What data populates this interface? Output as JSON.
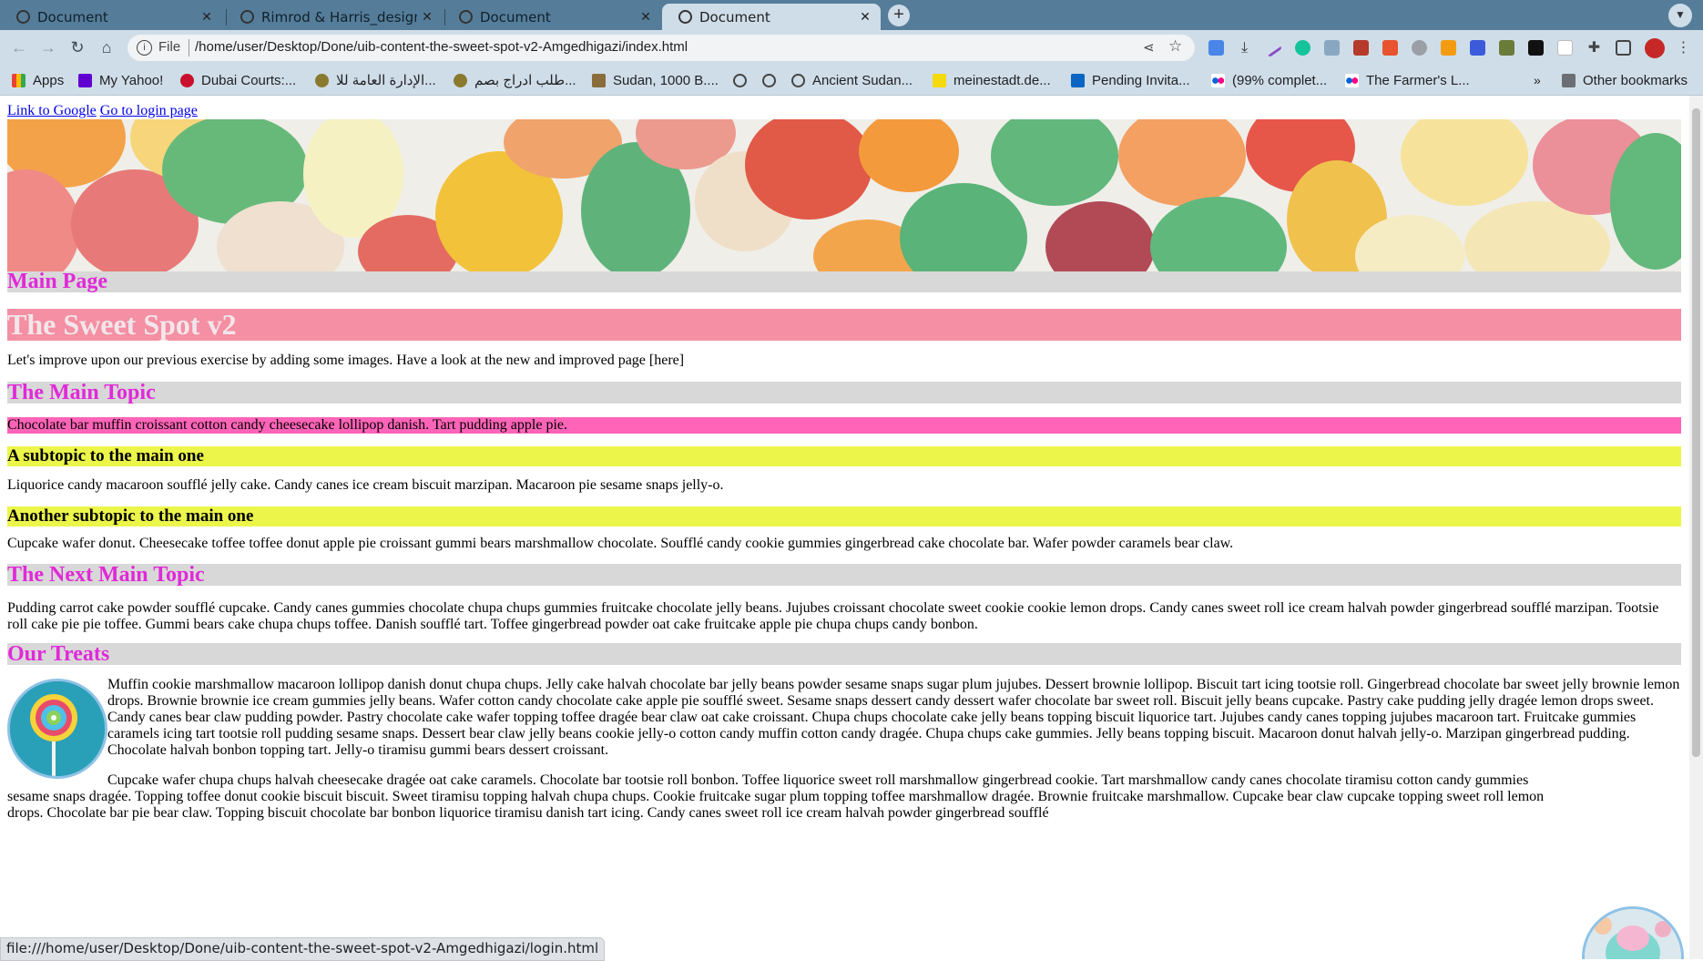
{
  "browser": {
    "tabs": [
      {
        "label": "Document",
        "active": false
      },
      {
        "label": "Rimrod & Harris_design s",
        "active": false
      },
      {
        "label": "Document",
        "active": false
      },
      {
        "label": "Document",
        "active": true
      }
    ],
    "new_tab_symbol": "+",
    "address": {
      "scheme_label": "File",
      "url": "/home/user/Desktop/Done/uib-content-the-sweet-spot-v2-Amgedhigazi/index.html"
    },
    "bookmarks": [
      {
        "label": "Apps",
        "icon": "apps-grid-icon"
      },
      {
        "label": "My Yahoo!",
        "icon": "yahoo-icon"
      },
      {
        "label": "Dubai Courts:...",
        "icon": "dubai-courts-icon"
      },
      {
        "label": "الإدارة العامة للا...",
        "icon": "emblem-icon"
      },
      {
        "label": "طلب ادراج بصم...",
        "icon": "emblem-icon"
      },
      {
        "label": "Sudan, 1000 B....",
        "icon": "folder-image-icon"
      },
      {
        "label": "",
        "icon": "globe-icon"
      },
      {
        "label": "",
        "icon": "globe-icon"
      },
      {
        "label": "Ancient Sudan...",
        "icon": "globe-icon"
      },
      {
        "label": "meinestadt.de...",
        "icon": "meinestadt-icon"
      },
      {
        "label": "Pending Invita...",
        "icon": "linkedin-icon"
      },
      {
        "label": "(99% complet...",
        "icon": "flickr-icon"
      },
      {
        "label": "The Farmer's L...",
        "icon": "flickr-icon"
      }
    ],
    "bookmarks_overflow": "»",
    "other_bookmarks": "Other bookmarks",
    "status_url": "file:///home/user/Desktop/Done/uib-content-the-sweet-spot-v2-Amgedhigazi/login.html"
  },
  "page": {
    "links": {
      "google": "Link to Google",
      "login": "Go to login page"
    },
    "main_page_heading": "Main Page",
    "title": "The Sweet Spot v2",
    "intro": "Let's improve upon our previous exercise by adding some images. Have a look at the new and improved page [here]",
    "main_topic_heading": "The Main Topic",
    "main_topic_text": "Chocolate bar muffin croissant cotton candy cheesecake lollipop danish. Tart pudding apple pie.",
    "subtopic1_heading": "A subtopic to the main one",
    "subtopic1_text": "Liquorice candy macaroon soufflé jelly cake. Candy canes ice cream biscuit marzipan. Macaroon pie sesame snaps jelly-o.",
    "subtopic2_heading": "Another subtopic to the main one",
    "subtopic2_text": "Cupcake wafer donut. Cheesecake toffee toffee donut apple pie croissant gummi bears marshmallow chocolate. Soufflé candy cookie gummies gingerbread cake chocolate bar. Wafer powder caramels bear claw.",
    "next_topic_heading": "The Next Main Topic",
    "next_topic_text": "Pudding carrot cake powder soufflé cupcake. Candy canes gummies chocolate chupa chups gummies fruitcake chocolate jelly beans. Jujubes croissant chocolate sweet cookie cookie lemon drops. Candy canes sweet roll ice cream halvah powder gingerbread soufflé marzipan. Tootsie roll cake pie pie toffee. Gummi bears cake chupa chups toffee. Danish soufflé tart. Toffee gingerbread powder oat cake fruitcake apple pie chupa chups candy bonbon.",
    "treats_heading": "Our Treats",
    "treats_text1": "Muffin cookie marshmallow macaroon lollipop danish donut chupa chups. Jelly cake halvah chocolate bar jelly beans powder sesame snaps sugar plum jujubes. Dessert brownie lollipop. Biscuit tart icing tootsie roll. Gingerbread chocolate bar sweet jelly brownie lemon drops. Brownie brownie ice cream gummies jelly beans. Wafer cotton candy chocolate cake apple pie soufflé sweet. Sesame snaps dessert candy dessert wafer chocolate bar sweet roll. Biscuit jelly beans cupcake. Pastry cake pudding jelly dragée lemon drops sweet. Candy canes bear claw pudding powder. Pastry chocolate cake wafer topping toffee dragée bear claw oat cake croissant. Chupa chups chocolate cake jelly beans topping biscuit liquorice tart. Jujubes candy canes topping jujubes macaroon tart. Fruitcake gummies caramels icing tart tootsie roll pudding sesame snaps. Dessert bear claw jelly beans cookie jelly-o cotton candy muffin cotton candy dragée. Chupa chups cake gummies. Jelly beans topping biscuit. Macaroon donut halvah jelly-o. Marzipan gingerbread pudding. Chocolate halvah bonbon topping tart. Jelly-o tiramisu gummi bears dessert croissant.",
    "treats_text2": "Cupcake wafer chupa chups halvah cheesecake dragée oat cake caramels. Chocolate bar tootsie roll bonbon. Toffee liquorice sweet roll marshmallow gingerbread cookie. Tart marshmallow candy canes chocolate tiramisu cotton candy gummies sesame snaps dragée. Topping toffee donut cookie biscuit biscuit. Sweet tiramisu topping halvah chupa chups. Cookie fruitcake sugar plum topping toffee marshmallow dragée. Brownie fruitcake marshmallow. Cupcake bear claw cupcake topping sweet roll lemon drops. Chocolate bar pie bear claw. Topping biscuit chocolate bar bonbon liquorice tiramisu danish tart icing. Candy canes sweet roll ice cream halvah powder gingerbread soufflé"
  },
  "colors": {
    "heading_gray_bg": "#d9d8d8",
    "heading_magenta": "#e02ad8",
    "title_bg": "#f58fa3",
    "hot_pink": "#ff64b8",
    "subtopic_yellow": "#ecf54a"
  }
}
